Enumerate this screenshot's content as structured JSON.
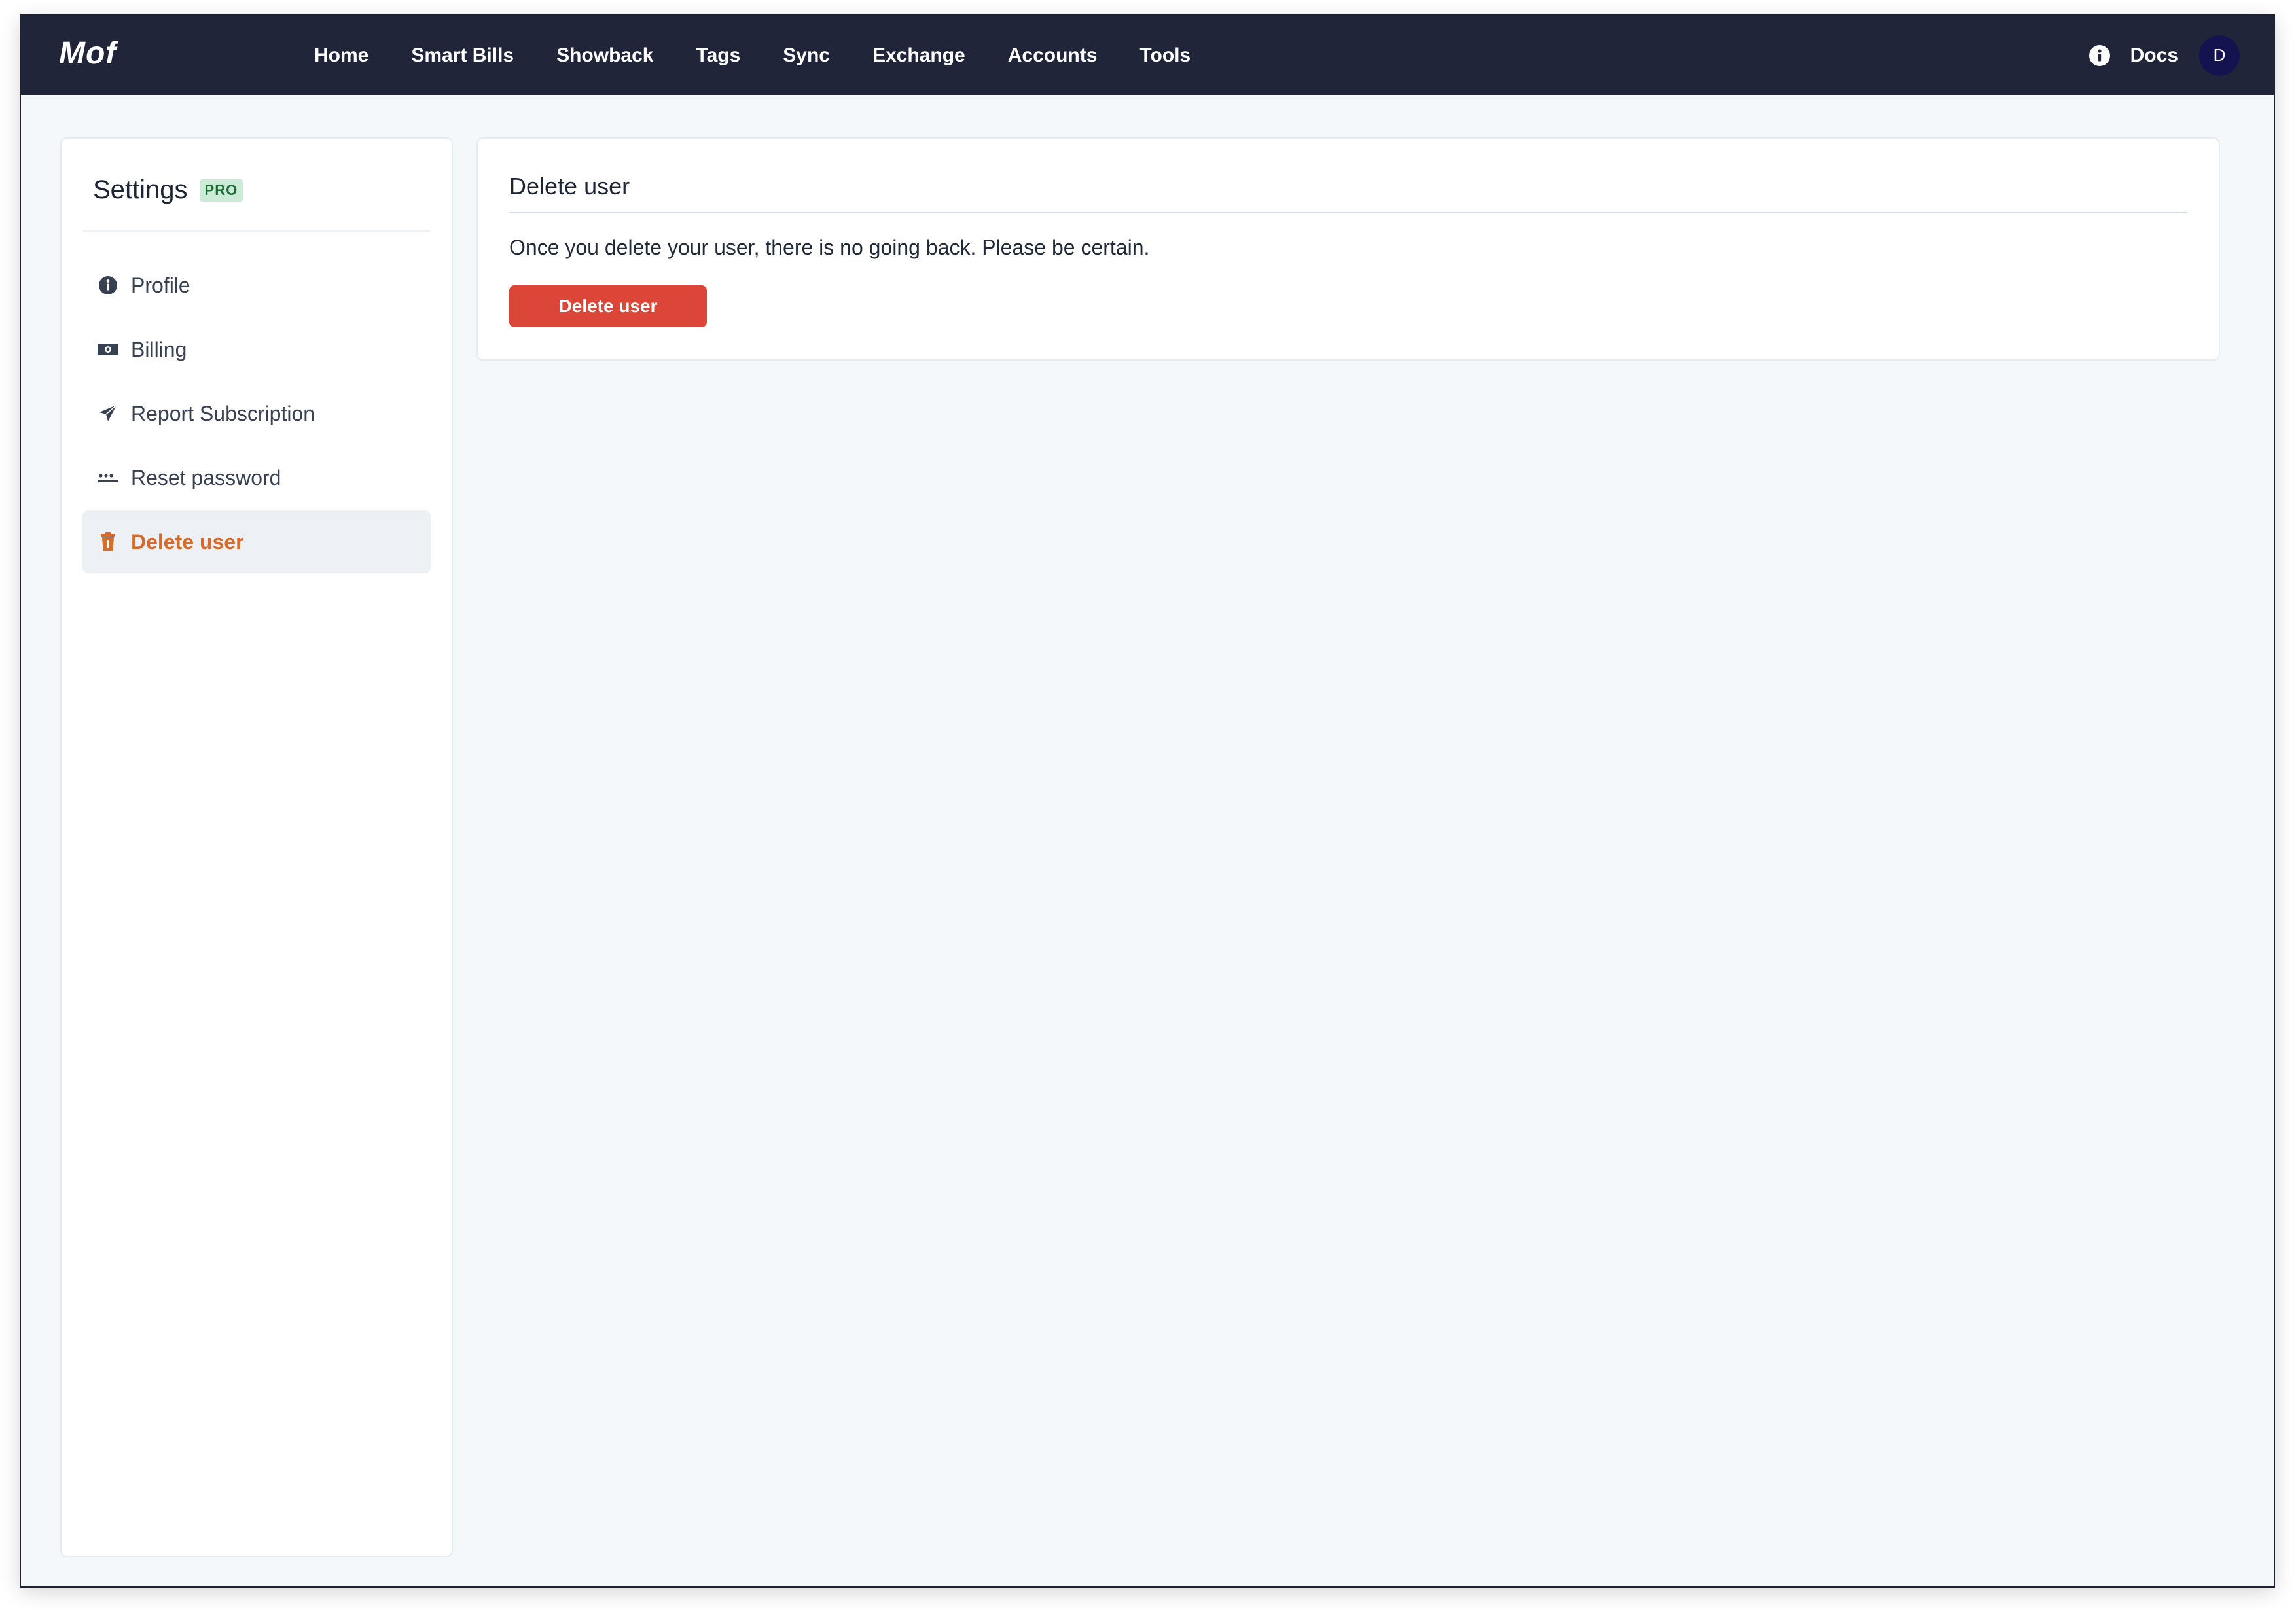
{
  "navbar": {
    "logo": "Mof",
    "links": [
      "Home",
      "Smart Bills",
      "Showback",
      "Tags",
      "Sync",
      "Exchange",
      "Accounts",
      "Tools"
    ],
    "docs_label": "Docs",
    "avatar_initial": "D",
    "info_icon": "info-circle-icon"
  },
  "sidebar": {
    "title": "Settings",
    "badge": "PRO",
    "items": [
      {
        "label": "Profile",
        "icon": "info-circle-icon",
        "active": false
      },
      {
        "label": "Billing",
        "icon": "money-bill-icon",
        "active": false
      },
      {
        "label": "Report Subscription",
        "icon": "paper-plane-icon",
        "active": false
      },
      {
        "label": "Reset password",
        "icon": "password-dots-icon",
        "active": false
      },
      {
        "label": "Delete user",
        "icon": "trash-icon",
        "active": true
      }
    ]
  },
  "main": {
    "card_title": "Delete user",
    "description": "Once you delete your user, there is no going back. Please be certain.",
    "button_label": "Delete user"
  },
  "colors": {
    "navbar_bg": "#20253a",
    "page_bg": "#f5f8fb",
    "accent_active": "#d86a2a",
    "danger": "#dc4638",
    "pro_badge_bg": "#ccebd7",
    "pro_badge_text": "#1e6b37",
    "avatar_bg": "#15134f"
  }
}
